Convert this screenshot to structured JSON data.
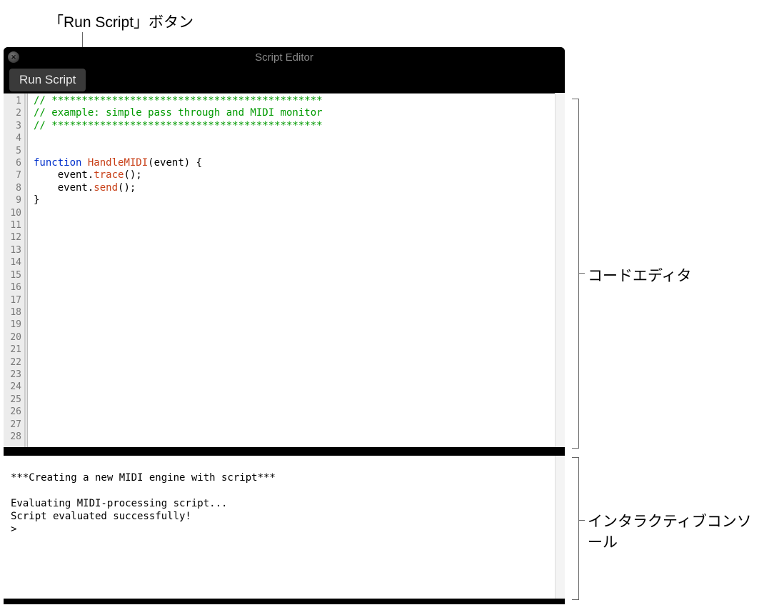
{
  "callouts": {
    "run_button": "「Run Script」ボタン",
    "code_editor": "コードエディタ",
    "console": "インタラクティブコンソール"
  },
  "window": {
    "title": "Script Editor",
    "toolbar": {
      "run_label": "Run Script"
    }
  },
  "code": {
    "line_count": 28,
    "lines": [
      {
        "type": "comment",
        "text": "// *********************************************"
      },
      {
        "type": "comment",
        "text": "// example: simple pass through and MIDI monitor"
      },
      {
        "type": "comment",
        "text": "// *********************************************"
      },
      {
        "type": "blank",
        "text": ""
      },
      {
        "type": "blank",
        "text": ""
      },
      {
        "type": "func",
        "keyword": "function",
        "name": "HandleMIDI",
        "rest": "(event) {"
      },
      {
        "type": "call",
        "indent": "    ",
        "obj": "event.",
        "method": "trace",
        "rest": "();"
      },
      {
        "type": "call",
        "indent": "    ",
        "obj": "event.",
        "method": "send",
        "rest": "();"
      },
      {
        "type": "plain",
        "text": "}"
      }
    ]
  },
  "console": {
    "lines": [
      "***Creating a new MIDI engine with script***",
      "",
      "Evaluating MIDI-processing script...",
      "Script evaluated successfully!",
      ">"
    ]
  }
}
